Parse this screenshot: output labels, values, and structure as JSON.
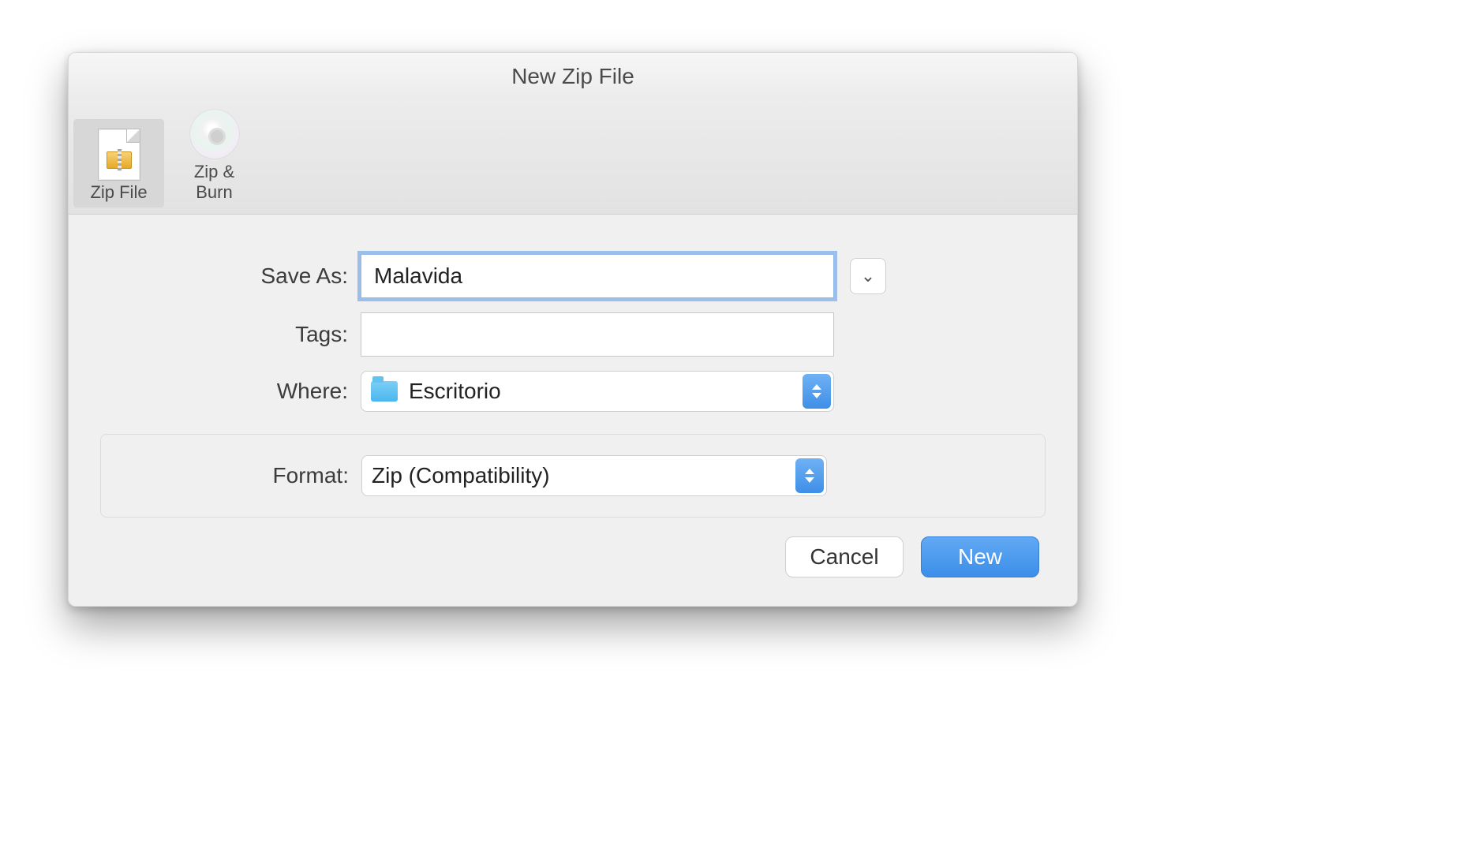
{
  "title": "New Zip File",
  "toolbar": {
    "items": [
      {
        "label": "Zip File",
        "selected": true
      },
      {
        "label": "Zip & Burn",
        "selected": false
      }
    ]
  },
  "form": {
    "save_as_label": "Save As:",
    "save_as_value": "Malavida",
    "tags_label": "Tags:",
    "tags_value": "",
    "where_label": "Where:",
    "where_value": "Escritorio",
    "format_label": "Format:",
    "format_value": "Zip (Compatibility)"
  },
  "buttons": {
    "cancel": "Cancel",
    "new": "New"
  },
  "colors": {
    "accent": "#3e8fe8",
    "focus_ring": "#5b97e5"
  }
}
